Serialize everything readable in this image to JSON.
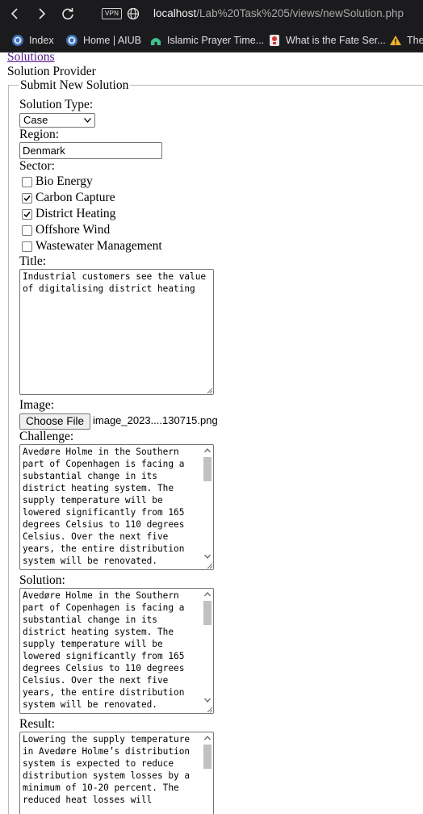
{
  "browser": {
    "url_host": "localhost",
    "url_path": "/Lab%20Task%205/views/newSolution.php",
    "vpn_label": "VPN",
    "bookmarks": [
      {
        "label": "Index",
        "icon": "shield-icon"
      },
      {
        "label": "Home | AIUB",
        "icon": "shield-icon"
      },
      {
        "label": "Islamic Prayer Time...",
        "icon": "mosque-icon"
      },
      {
        "label": "What is the Fate Ser...",
        "icon": "quiz-icon"
      },
      {
        "label": "The",
        "icon": "warning-icon"
      }
    ]
  },
  "page": {
    "solutions_link": "Solutions",
    "provider_text": "Solution Provider",
    "legend": "Submit New Solution",
    "solution_type_label": "Solution Type:",
    "solution_type_value": "Case",
    "region_label": "Region:",
    "region_value": "Denmark",
    "sector_label": "Sector:",
    "sectors": [
      {
        "label": "Bio Energy",
        "checked": false
      },
      {
        "label": "Carbon Capture",
        "checked": true
      },
      {
        "label": "District Heating",
        "checked": true
      },
      {
        "label": "Offshore Wind",
        "checked": false
      },
      {
        "label": "Wastewater Management",
        "checked": false
      }
    ],
    "title_label": "Title:",
    "title_value": "Industrial customers see the value of digitalising district heating",
    "image_label": "Image:",
    "choose_file_label": "Choose File",
    "file_name": "image_2023....130715.png",
    "challenge_label": "Challenge:",
    "challenge_value": "Avedøre Holme in the Southern part of Copenhagen is facing a substantial change in its district heating system. The supply temperature will be lowered significantly from 165 degrees Celsius to 110 degrees Celsius. Over the next five years, the entire distribution system will be renovated.",
    "solution_label": "Solution:",
    "solution_value": "Avedøre Holme in the Southern part of Copenhagen is facing a substantial change in its district heating system. The supply temperature will be lowered significantly from 165 degrees Celsius to 110 degrees Celsius. Over the next five years, the entire distribution system will be renovated.",
    "result_label": "Result:",
    "result_value": "Lowering the supply temperature in Avedøre Holme’s distribution system is expected to reduce distribution system losses by a minimum of 10-20 percent. The reduced heat losses will"
  },
  "colors": {
    "chrome_bg": "#1b1b1e",
    "link": "#551a8b",
    "thumb": "#c1c1c1"
  }
}
